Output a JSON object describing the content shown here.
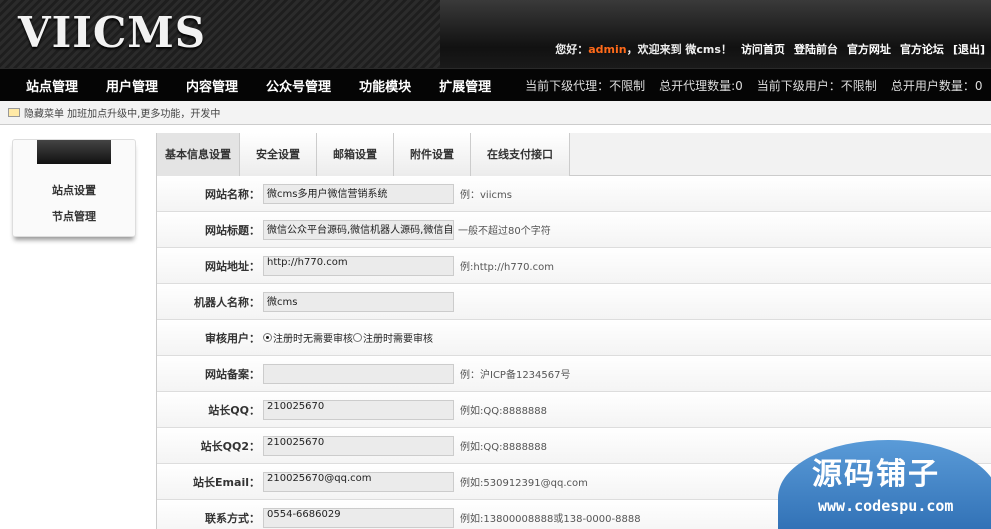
{
  "header": {
    "logo_text": "VIICMS",
    "greeting_prefix": "您好：",
    "username": "admin",
    "greeting_suffix": "，欢迎来到 微cms！",
    "links": [
      "访问首页",
      "登陆前台",
      "官方网址",
      "官方论坛",
      "[退出]"
    ]
  },
  "nav": {
    "items": [
      "站点管理",
      "用户管理",
      "内容管理",
      "公众号管理",
      "功能模块",
      "扩展管理"
    ],
    "stats": [
      "当前下级代理：不限制",
      "总开代理数量:0",
      "当前下级用户：不限制",
      "总开用户数量：0"
    ]
  },
  "notice": {
    "text": "隐藏菜单 加班加点升级中,更多功能，开发中"
  },
  "sidebar": {
    "items": [
      "站点设置",
      "节点管理"
    ]
  },
  "tabs": [
    "基本信息设置",
    "安全设置",
    "邮箱设置",
    "附件设置",
    "在线支付接口"
  ],
  "form": {
    "site_name": {
      "label": "网站名称：",
      "value": "微cms多用户微信营销系统",
      "hint": "例：viicms"
    },
    "site_title": {
      "label": "网站标题：",
      "value": "微信公众平台源码,微信机器人源码,微信自动回复",
      "hint": "一般不超过80个字符"
    },
    "site_url": {
      "label": "网站地址：",
      "value": "http://h770.com",
      "hint": "例:http://h770.com"
    },
    "robot_name": {
      "label": "机器人名称：",
      "value": "微cms"
    },
    "review_user": {
      "label": "审核用户：",
      "option1": "注册时无需要审核",
      "option2": "注册时需要审核"
    },
    "icp": {
      "label": "网站备案：",
      "value": "",
      "hint": "例：沪ICP备1234567号"
    },
    "qq": {
      "label": "站长QQ：",
      "value": "210025670",
      "hint": "例如:QQ:8888888"
    },
    "qq2": {
      "label": "站长QQ2：",
      "value": "210025670",
      "hint": "例如:QQ:8888888"
    },
    "email": {
      "label": "站长Email：",
      "value": "210025670@qq.com",
      "hint": "例如:530912391@qq.com"
    },
    "phone": {
      "label": "联系方式：",
      "value": "0554-6686029",
      "hint": "例如:13800008888或138-0000-8888"
    }
  },
  "watermark": {
    "title": "源码铺子",
    "url": "www.codespu.com"
  }
}
